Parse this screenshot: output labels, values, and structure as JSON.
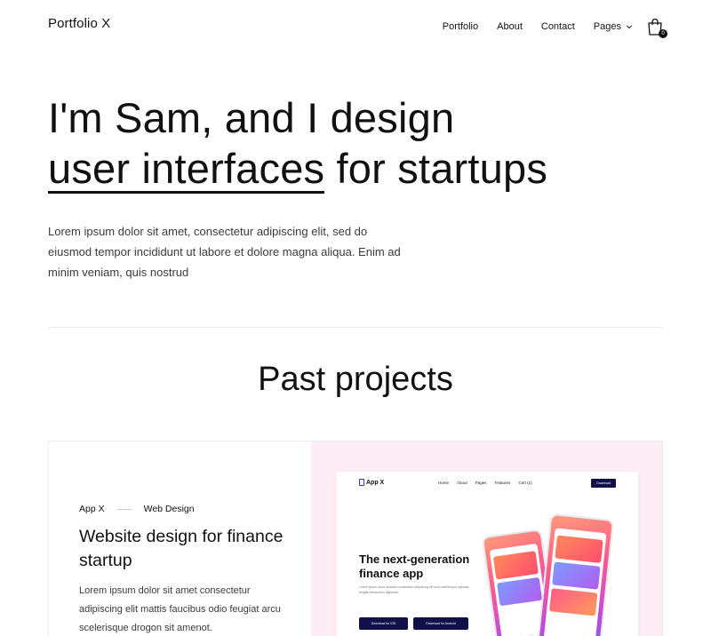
{
  "header": {
    "brand": "Portfolio X",
    "nav": [
      "Portfolio",
      "About",
      "Contact",
      "Pages"
    ],
    "cart_count": "0"
  },
  "hero": {
    "title_line1": "I'm Sam, and I design",
    "title_underlined": "user interfaces",
    "title_rest": " for startups",
    "description": "Lorem ipsum dolor sit amet, consectetur adipiscing elit, sed do eiusmod tempor incididunt ut labore et dolore magna aliqua. Enim ad minim veniam, quis nostrud"
  },
  "projects": {
    "title": "Past projects",
    "items": [
      {
        "client": "App X",
        "category": "Web Design",
        "title": "Website design for finance startup",
        "description": "Lorem ipsum dolor sit amet consectetur adipiscing elit mattis faucibus odio feugiat arcu scelerisque drogon sit amenot.",
        "preview": {
          "logo": "App X",
          "nav": [
            "Home",
            "About",
            "Pages",
            "Features",
            "Cart (1)"
          ],
          "button": "Download",
          "headline": "The next-generation finance app",
          "text": "Lorem ipsum dolor sit amet consectetur adipiscing elit urna velit tempor egestas fringilla fermentum dignissim.",
          "btn_ios": "Download for iOS",
          "btn_android": "Download for Android"
        }
      }
    ]
  },
  "colors": {
    "text": "#111111",
    "muted": "#3b3b3b",
    "card_bg": "#fdeef6",
    "mock_button": "#12104a"
  }
}
